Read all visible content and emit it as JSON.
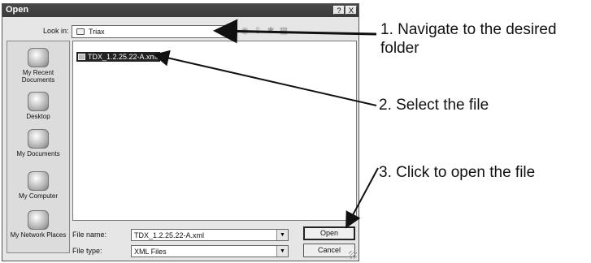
{
  "dialog": {
    "title": "Open",
    "help_button": "?",
    "close_button": "X",
    "look_in_label": "Look in:",
    "look_in_value": "Triax",
    "toolbar_icons": [
      "back-icon",
      "up-folder-icon",
      "new-folder-icon",
      "views-menu-icon"
    ],
    "places": [
      {
        "label": "My Recent Documents",
        "icon": "recent-documents-icon"
      },
      {
        "label": "Desktop",
        "icon": "desktop-icon"
      },
      {
        "label": "My Documents",
        "icon": "my-documents-icon"
      },
      {
        "label": "My Computer",
        "icon": "my-computer-icon"
      },
      {
        "label": "My Network Places",
        "icon": "network-places-icon"
      }
    ],
    "files": [
      {
        "name": "TDX_1.2.25.22-A.xml",
        "selected": true
      }
    ],
    "file_name_label": "File name:",
    "file_name_value": "TDX_1.2.25.22-A.xml",
    "file_type_label": "File type:",
    "file_type_value": "XML Files",
    "open_button": "Open",
    "cancel_button": "Cancel"
  },
  "annotations": {
    "step1_line1": "1. Navigate to the desired",
    "step1_line2": "folder",
    "step2": "2. Select the file",
    "step3": "3. Click to open the file"
  }
}
